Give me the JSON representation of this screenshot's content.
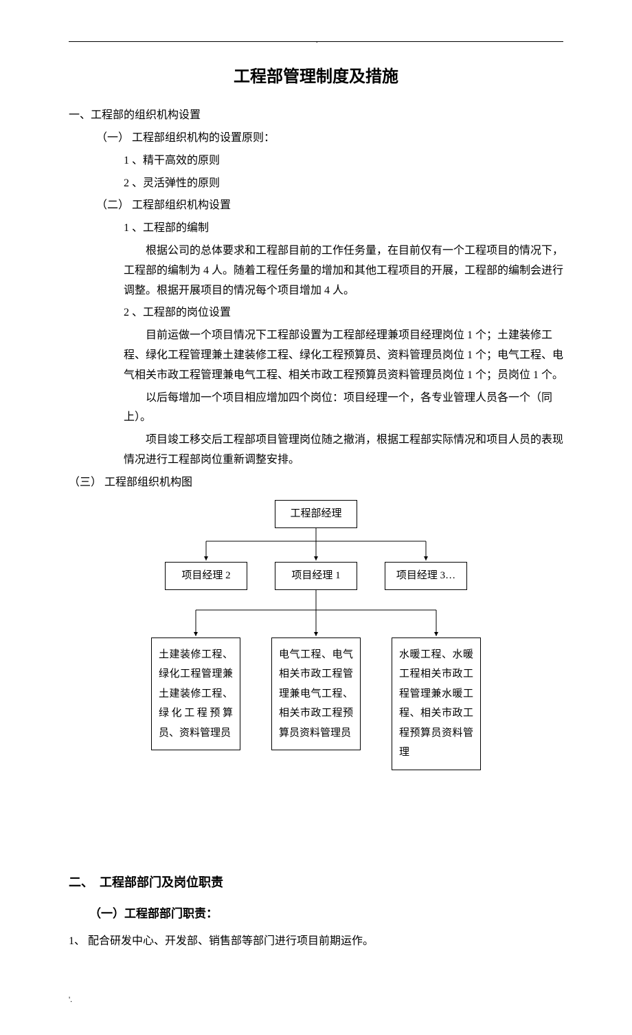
{
  "title": "工程部管理制度及措施",
  "section1": {
    "heading": "一、工程部的组织机构设置",
    "sub1": {
      "heading": "（一） 工程部组织机构的设置原则：",
      "item1": "1 、精干高效的原则",
      "item2": "2 、灵活弹性的原则"
    },
    "sub2": {
      "heading": "（二） 工程部组织机构设置",
      "item1_title": "1 、工程部的编制",
      "item1_p1": "根据公司的总体要求和工程部目前的工作任务量，在目前仅有一个工程项目的情况下，工程部的编制为 4 人。随着工程任务量的增加和其他工程项目的开展，工程部的编制会进行调整。根据开展项目的情况每个项目增加 4 人。",
      "item2_title": "2 、工程部的岗位设置",
      "item2_p1": "目前运做一个项目情况下工程部设置为工程部经理兼项目经理岗位 1 个；土建装修工程、绿化工程管理兼土建装修工程、绿化工程预算员、资料管理员岗位 1 个；电气工程、电气相关市政工程管理兼电气工程、相关市政工程预算员资料管理员岗位 1 个；员岗位 1 个。",
      "item2_p2": "以后每增加一个项目相应增加四个岗位：项目经理一个，各专业管理人员各一个（同上）。",
      "item2_p3": "项目竣工移交后工程部项目管理岗位随之撤消，根据工程部实际情况和项目人员的表现情况进行工程部岗位重新调整安排。"
    },
    "sub3": {
      "heading": "（三） 工程部组织机构图"
    }
  },
  "orgchart": {
    "top": "工程部经理",
    "mid1": "项目经理 2",
    "mid2": "项目经理 1",
    "mid3": "项目经理 3…",
    "bot1": "土建装修工程、绿化工程管理兼土建装修工程、绿化工程预算员、资料管理员",
    "bot2": "电气工程、电气相关市政工程管理兼电气工程、相关市政工程预算员资料管理员",
    "bot3": "水暖工程、水暖工程相关市政工程管理兼水暖工程、相关市政工程预算员资料管理"
  },
  "section2": {
    "heading": "二、　工程部部门及岗位职责",
    "sub1": {
      "heading": "（一）工程部部门职责：",
      "item1": "1、 配合研发中心、开发部、销售部等部门进行项目前期运作。"
    }
  },
  "footer": "'."
}
